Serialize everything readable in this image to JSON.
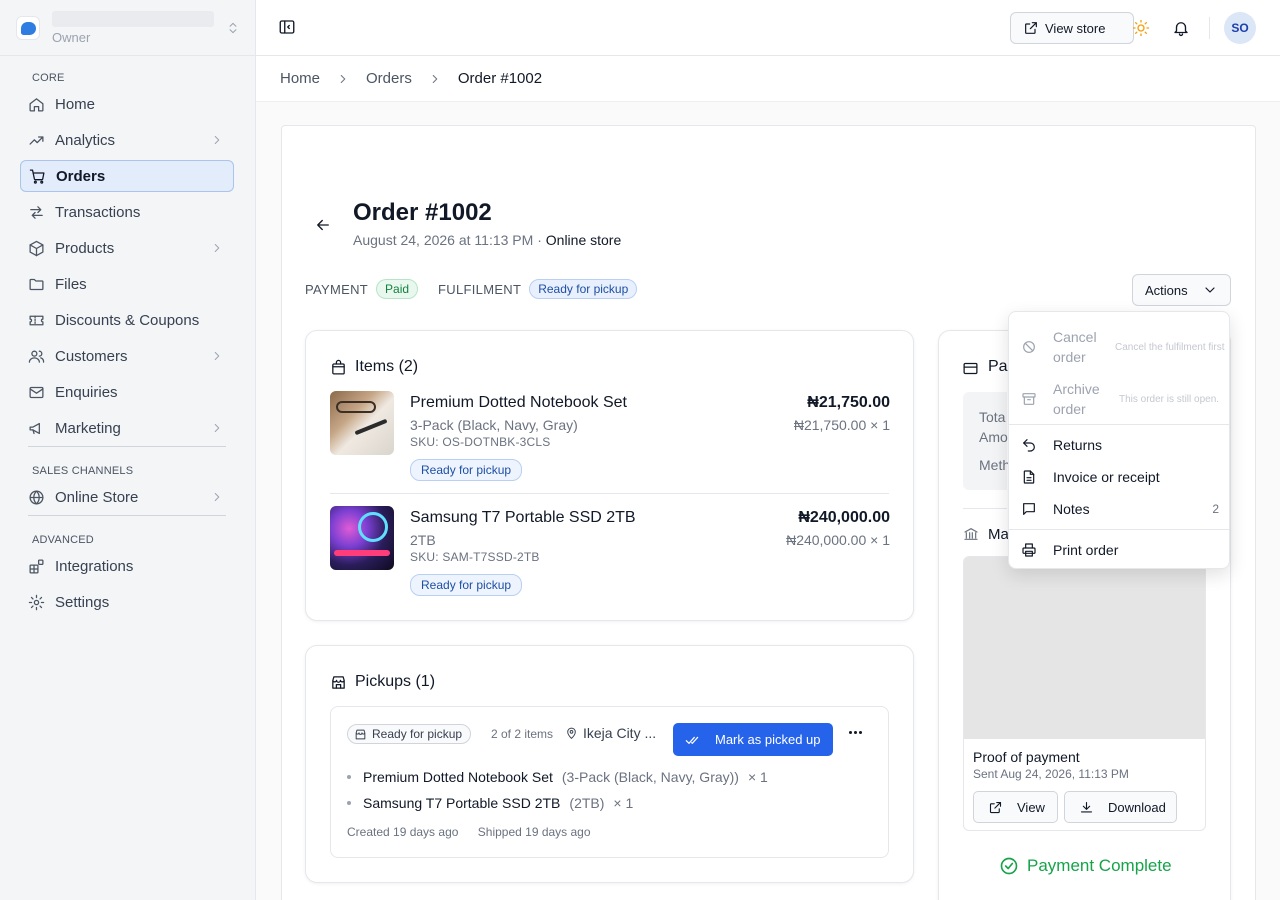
{
  "store": {
    "role": "Owner"
  },
  "sidebar": {
    "sections": {
      "core": "CORE",
      "sales": "SALES CHANNELS",
      "advanced": "ADVANCED"
    },
    "items": {
      "home": "Home",
      "analytics": "Analytics",
      "orders": "Orders",
      "transactions": "Transactions",
      "products": "Products",
      "files": "Files",
      "discounts": "Discounts & Coupons",
      "customers": "Customers",
      "enquiries": "Enquiries",
      "marketing": "Marketing",
      "online_store": "Online Store",
      "integrations": "Integrations",
      "settings": "Settings"
    },
    "active": "orders"
  },
  "topbar": {
    "view_store": "View store",
    "avatar_initials": "SO"
  },
  "breadcrumb": {
    "home": "Home",
    "orders": "Orders",
    "current": "Order #1002"
  },
  "order": {
    "title": "Order #1002",
    "date": "August 24, 2026 at 11:13 PM",
    "separator": " · ",
    "channel": "Online store",
    "payment_label": "PAYMENT",
    "payment_status": "Paid",
    "fulfilment_label": "FULFILMENT",
    "fulfilment_status": "Ready for pickup",
    "actions_label": "Actions"
  },
  "items_panel": {
    "title": "Items (2)",
    "items": [
      {
        "name": "Premium Dotted Notebook Set",
        "variant": "3-Pack (Black, Navy, Gray)",
        "sku": "SKU: OS-DOTNBK-3CLS",
        "status": "Ready for pickup",
        "price": "₦21,750.00",
        "unit": "₦21,750.00 × 1"
      },
      {
        "name": "Samsung T7 Portable SSD 2TB",
        "variant": "2TB",
        "sku": "SKU: SAM-T7SSD-2TB",
        "status": "Ready for pickup",
        "price": "₦240,000.00",
        "unit": "₦240,000.00 × 1"
      }
    ]
  },
  "pickups_panel": {
    "title": "Pickups (1)",
    "status": "Ready for pickup",
    "count": "2 of 2 items",
    "location": "Ikeja City ...",
    "mark_button": "Mark as picked up",
    "lines": [
      {
        "name": "Premium Dotted Notebook Set",
        "variant": "(3-Pack (Black, Navy, Gray))",
        "qty": "× 1"
      },
      {
        "name": "Samsung T7 Portable SSD 2TB",
        "variant": "(2TB)",
        "qty": "× 1"
      }
    ],
    "created": "Created 19 days ago",
    "shipped": "Shipped 19 days ago"
  },
  "payment_panel": {
    "title_fragment": "Pa",
    "total_fragment": "Tota",
    "amount_fragment": "Amo",
    "method_fragment": "Meth",
    "manual_fragment": "Ma",
    "proof_title": "Proof of payment",
    "proof_sent": "Sent Aug 24, 2026, 11:13 PM",
    "view_button": "View",
    "download_button": "Download",
    "complete": "Payment Complete"
  },
  "actions_menu": {
    "cancel": "Cancel order",
    "cancel_hint": "Cancel the fulfilment first",
    "archive": "Archive order",
    "archive_hint": "This order is still open.",
    "returns": "Returns",
    "invoice": "Invoice or receipt",
    "notes": "Notes",
    "notes_count": "2",
    "print": "Print order"
  },
  "colors": {
    "accent": "#2563eb",
    "success": "#16a34a",
    "active_bg": "#e3ecfa",
    "warning": "#f59e0b"
  }
}
